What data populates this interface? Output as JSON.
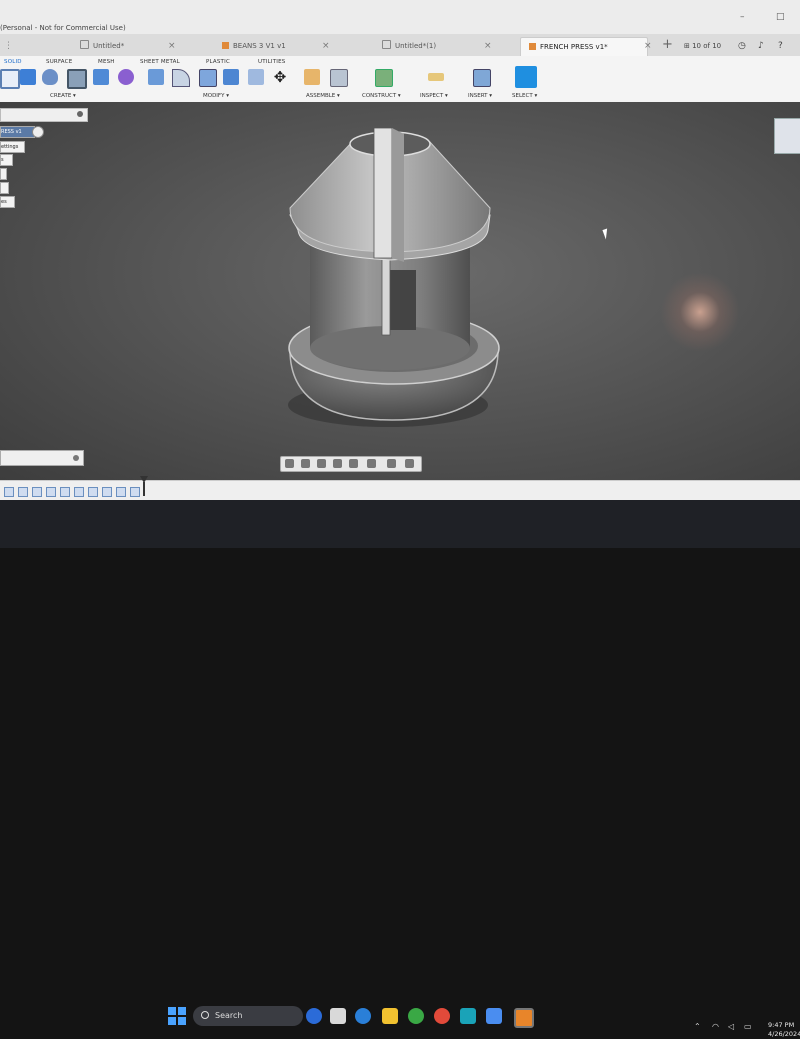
{
  "window": {
    "title": "(Personal - Not for Commercial Use)",
    "minimize": "–",
    "maximize": "□"
  },
  "tabs": [
    {
      "label": "Untitled*"
    },
    {
      "label": "BEANS 3 V1 v1"
    },
    {
      "label": "Untitled*(1)"
    },
    {
      "label": "FRENCH PRESS v1*",
      "active": true
    }
  ],
  "tab_close": "×",
  "tab_add": "+",
  "tab_count": "10 of 10",
  "ribbon": {
    "tabs": [
      "SOLID",
      "SURFACE",
      "MESH",
      "SHEET METAL",
      "PLASTIC",
      "UTILITIES"
    ],
    "groups": [
      "CREATE ▾",
      "MODIFY ▾",
      "ASSEMBLE ▾",
      "CONSTRUCT ▾",
      "INSPECT ▾",
      "INSERT ▾",
      "SELECT ▾"
    ]
  },
  "browser": {
    "root": "RESS v1",
    "items": [
      "ettings",
      "s",
      "",
      "",
      "es"
    ]
  },
  "taskbar": {
    "search_placeholder": "Search",
    "time": "9:47 PM",
    "date": "4/26/2024"
  },
  "colors": {
    "accent": "#1b6ac9",
    "viewport": "#5a5a5a",
    "taskbar": "#1f2126"
  }
}
